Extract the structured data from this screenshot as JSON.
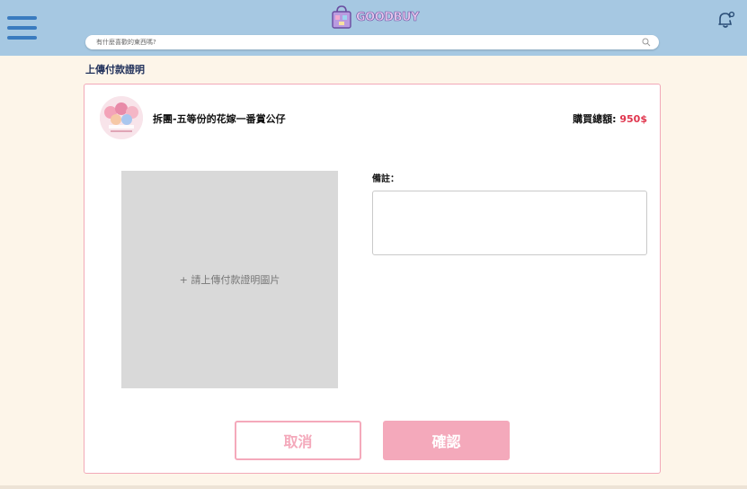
{
  "header": {
    "logo_text": "GOODBUY",
    "search_placeholder": "有什麼喜歡的東西嗎?",
    "colors": {
      "bar": "#a6c8e2",
      "menu": "#3a7bbf"
    }
  },
  "page": {
    "title": "上傳付款證明"
  },
  "order": {
    "product_name": "拆團-五等份的花嫁一番賞公仔",
    "total_label": "購買總額: ",
    "total_amount": "950$",
    "accent_color": "#e0364e"
  },
  "upload": {
    "label": "+ 請上傳付款證明圖片"
  },
  "note": {
    "label": "備註：",
    "value": ""
  },
  "actions": {
    "cancel_label": "取消",
    "confirm_label": "確認",
    "pink": "#f4a9bb"
  }
}
